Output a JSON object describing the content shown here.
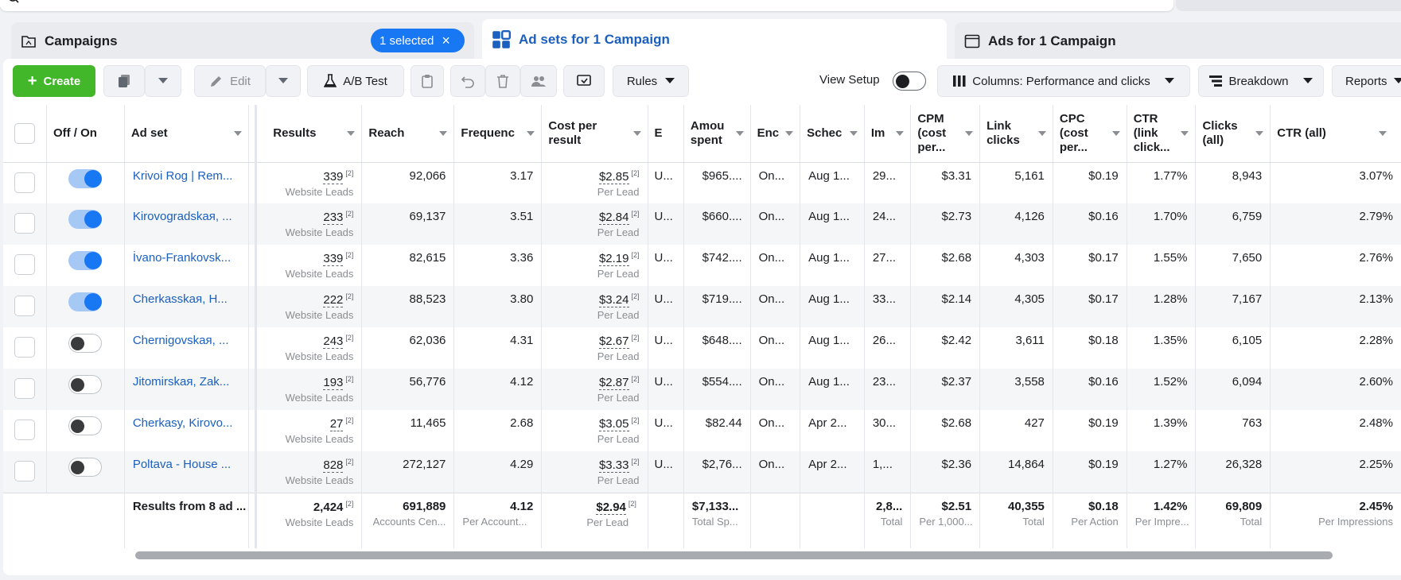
{
  "tabs": {
    "campaigns": {
      "label": "Campaigns",
      "selected_badge": "1 selected"
    },
    "adsets": {
      "label": "Ad sets for 1 Campaign"
    },
    "ads": {
      "label": "Ads for 1 Campaign"
    }
  },
  "toolbar": {
    "create": "Create",
    "edit": "Edit",
    "ab_test": "A/B Test",
    "rules": "Rules",
    "view_setup": "View Setup",
    "columns": "Columns: Performance and clicks",
    "breakdown": "Breakdown",
    "reports": "Reports"
  },
  "columns": {
    "off_on": "Off / On",
    "ad_set": "Ad set",
    "results": "Results",
    "reach": "Reach",
    "frequency": "Frequenc",
    "cost_per_result": "Cost per result",
    "b": "E",
    "amount_spent": "Amou spent",
    "ends": "Enc",
    "schedule": "Schec",
    "impressions": "Im",
    "cpm": "CPM (cost per...",
    "link_clicks": "Link clicks",
    "cpc": "CPC (cost per...",
    "ctr_link": "CTR (link click...",
    "clicks_all": "Clicks (all)",
    "ctr_all": "CTR (all)"
  },
  "rows": [
    {
      "on": true,
      "name": "Krivoi Rog | Rem...",
      "results": "339",
      "results_sub": "Website Leads",
      "reach": "92,066",
      "freq": "3.17",
      "cpr": "$2.85",
      "cpr_sub": "Per Lead",
      "b": "U...",
      "spent": "$965....",
      "ends": "On...",
      "sched": "Aug 1...",
      "impr": "29...",
      "cpm": "$3.31",
      "link": "5,161",
      "cpc": "$0.19",
      "ctrl": "1.77%",
      "clicks": "8,943",
      "ctra": "3.07%"
    },
    {
      "on": true,
      "name": "Kirovogradskaя, ...",
      "results": "233",
      "results_sub": "Website Leads",
      "reach": "69,137",
      "freq": "3.51",
      "cpr": "$2.84",
      "cpr_sub": "Per Lead",
      "b": "U...",
      "spent": "$660....",
      "ends": "On...",
      "sched": "Aug 1...",
      "impr": "24...",
      "cpm": "$2.73",
      "link": "4,126",
      "cpc": "$0.16",
      "ctrl": "1.70%",
      "clicks": "6,759",
      "ctra": "2.79%"
    },
    {
      "on": true,
      "name": "İvano-Frankovsk...",
      "results": "339",
      "results_sub": "Website Leads",
      "reach": "82,615",
      "freq": "3.36",
      "cpr": "$2.19",
      "cpr_sub": "Per Lead",
      "b": "U...",
      "spent": "$742....",
      "ends": "On...",
      "sched": "Aug 1...",
      "impr": "27...",
      "cpm": "$2.68",
      "link": "4,303",
      "cpc": "$0.17",
      "ctrl": "1.55%",
      "clicks": "7,650",
      "ctra": "2.76%"
    },
    {
      "on": true,
      "name": "Cherkasskaя, H...",
      "results": "222",
      "results_sub": "Website Leads",
      "reach": "88,523",
      "freq": "3.80",
      "cpr": "$3.24",
      "cpr_sub": "Per Lead",
      "b": "U...",
      "spent": "$719....",
      "ends": "On...",
      "sched": "Aug 1...",
      "impr": "33...",
      "cpm": "$2.14",
      "link": "4,305",
      "cpc": "$0.17",
      "ctrl": "1.28%",
      "clicks": "7,167",
      "ctra": "2.13%"
    },
    {
      "on": false,
      "name": "Chernigovskaя, ...",
      "results": "243",
      "results_sub": "Website Leads",
      "reach": "62,036",
      "freq": "4.31",
      "cpr": "$2.67",
      "cpr_sub": "Per Lead",
      "b": "U...",
      "spent": "$648....",
      "ends": "On...",
      "sched": "Aug 1...",
      "impr": "26...",
      "cpm": "$2.42",
      "link": "3,611",
      "cpc": "$0.18",
      "ctrl": "1.35%",
      "clicks": "6,105",
      "ctra": "2.28%"
    },
    {
      "on": false,
      "name": "Jitomirskaя, Zak...",
      "results": "193",
      "results_sub": "Website Leads",
      "reach": "56,776",
      "freq": "4.12",
      "cpr": "$2.87",
      "cpr_sub": "Per Lead",
      "b": "U...",
      "spent": "$554....",
      "ends": "On...",
      "sched": "Aug 1...",
      "impr": "23...",
      "cpm": "$2.37",
      "link": "3,558",
      "cpc": "$0.16",
      "ctrl": "1.52%",
      "clicks": "6,094",
      "ctra": "2.60%"
    },
    {
      "on": false,
      "name": "Cherkasy, Kirovo...",
      "results": "27",
      "results_sub": "Website Leads",
      "reach": "11,465",
      "freq": "2.68",
      "cpr": "$3.05",
      "cpr_sub": "Per Lead",
      "b": "U...",
      "spent": "$82.44",
      "ends": "On...",
      "sched": "Apr 2...",
      "impr": "30...",
      "cpm": "$2.68",
      "link": "427",
      "cpc": "$0.19",
      "ctrl": "1.39%",
      "clicks": "763",
      "ctra": "2.48%"
    },
    {
      "on": false,
      "name": "Poltava - House ...",
      "results": "828",
      "results_sub": "Website Leads",
      "reach": "272,127",
      "freq": "4.29",
      "cpr": "$3.33",
      "cpr_sub": "Per Lead",
      "b": "U...",
      "spent": "$2,76...",
      "ends": "On...",
      "sched": "Apr 2...",
      "impr": "1,...",
      "cpm": "$2.36",
      "link": "14,864",
      "cpc": "$0.19",
      "ctrl": "1.27%",
      "clicks": "26,328",
      "ctra": "2.25%"
    }
  ],
  "totals": {
    "label": "Results from 8 ad ...",
    "results": "2,424",
    "results_sub": "Website Leads",
    "reach": "691,889",
    "reach_sub": "Accounts Cen...",
    "freq": "4.12",
    "freq_sub": "Per Account...",
    "cpr": "$2.94",
    "cpr_sub": "Per Lead",
    "spent": "$7,133...",
    "spent_sub": "Total Sp...",
    "impr": "2,8...",
    "impr_sub": "Total",
    "cpm": "$2.51",
    "cpm_sub": "Per 1,000...",
    "link": "40,355",
    "link_sub": "Total",
    "cpc": "$0.18",
    "cpc_sub": "Per Action",
    "ctrl": "1.42%",
    "ctrl_sub": "Per Impre...",
    "clicks": "69,809",
    "clicks_sub": "Total",
    "ctra": "2.45%",
    "ctra_sub": "Per Impressions"
  },
  "ref_marker": "[2]",
  "colors": {
    "accent": "#1877f2",
    "create": "#42b72a",
    "link": "#1b5fbf"
  }
}
